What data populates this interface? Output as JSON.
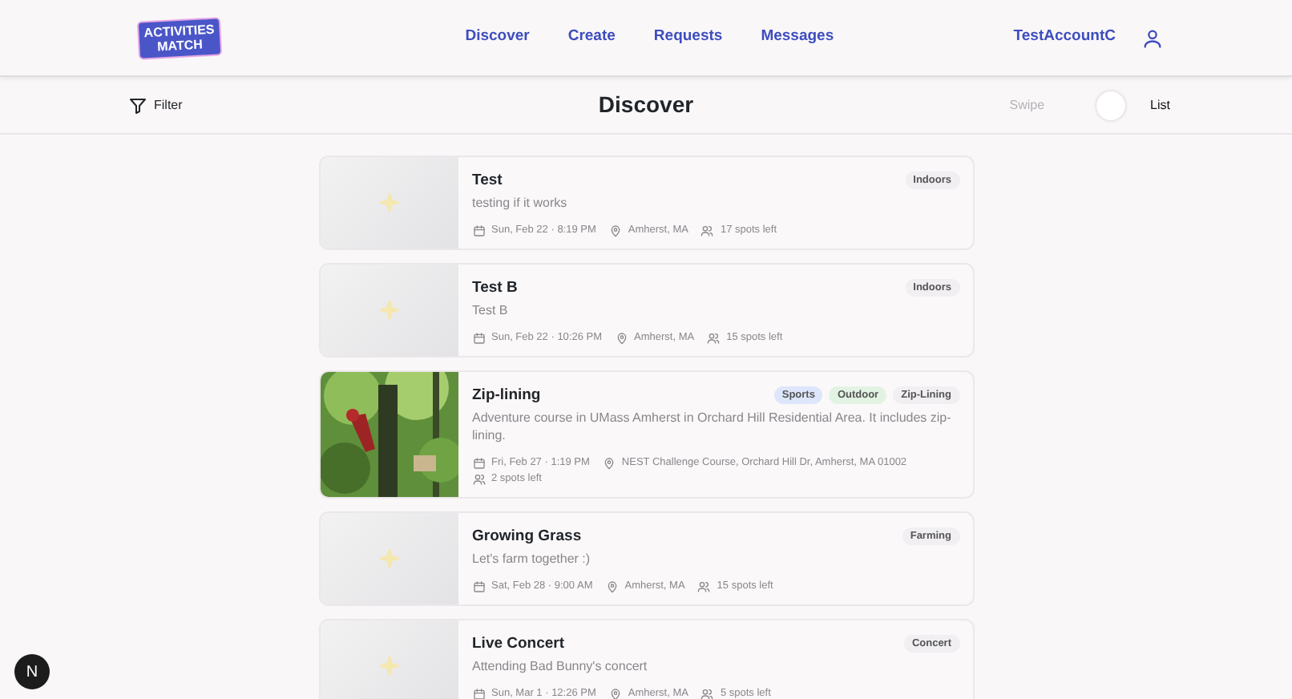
{
  "logo": {
    "lines": [
      "ACTIVITIES",
      "MATCH"
    ]
  },
  "nav": [
    {
      "label": "Discover"
    },
    {
      "label": "Create"
    },
    {
      "label": "Requests"
    },
    {
      "label": "Messages"
    }
  ],
  "account": {
    "name": "TestAccountC"
  },
  "toolbar": {
    "filter": "Filter",
    "title": "Discover",
    "modes": [
      {
        "label": "Swipe",
        "selected": false
      },
      {
        "label": "List",
        "selected": true
      }
    ]
  },
  "activities": [
    {
      "title": "Test",
      "description": "testing if it works",
      "date": "Sun, Feb 22 · 8:19 PM",
      "location": "Amherst, MA",
      "spots": "17 spots left",
      "image": {
        "kind": "placeholder"
      },
      "tags": [
        {
          "label": "Indoors",
          "color": "#f1eff2"
        }
      ]
    },
    {
      "title": "Test B",
      "description": "Test B",
      "date": "Sun, Feb 22 · 10:26 PM",
      "location": "Amherst, MA",
      "spots": "15 spots left",
      "image": {
        "kind": "placeholder"
      },
      "tags": [
        {
          "label": "Indoors",
          "color": "#f1eff2"
        }
      ]
    },
    {
      "title": "Zip-lining",
      "description": "Adventure course in UMass Amherst in Orchard Hill Residential Area. It includes zip-lining.",
      "date": "Fri, Feb 27 · 1:19 PM",
      "location": "NEST Challenge Course, Orchard Hill Dr, Amherst, MA 01002",
      "spots": "2 spots left",
      "image": {
        "kind": "picture"
      },
      "tags": [
        {
          "label": "Sports",
          "color": "#dde6fb"
        },
        {
          "label": "Outdoor",
          "color": "#e2f3e3"
        },
        {
          "label": "Zip-Lining",
          "color": "#f1eff2"
        }
      ]
    },
    {
      "title": "Growing Grass",
      "description": "Let's farm together :)",
      "date": "Sat, Feb 28 · 9:00 AM",
      "location": "Amherst, MA",
      "spots": "15 spots left",
      "image": {
        "kind": "placeholder"
      },
      "tags": [
        {
          "label": "Farming",
          "color": "#f1eff2"
        }
      ]
    },
    {
      "title": "Live Concert",
      "description": "Attending Bad Bunny's concert",
      "date": "Sun, Mar 1 · 12:26 PM",
      "location": "Amherst, MA",
      "spots": "5 spots left",
      "image": {
        "kind": "placeholder"
      },
      "tags": [
        {
          "label": "Concert",
          "color": "#f1eff2"
        }
      ]
    }
  ],
  "dev_badge": "N"
}
